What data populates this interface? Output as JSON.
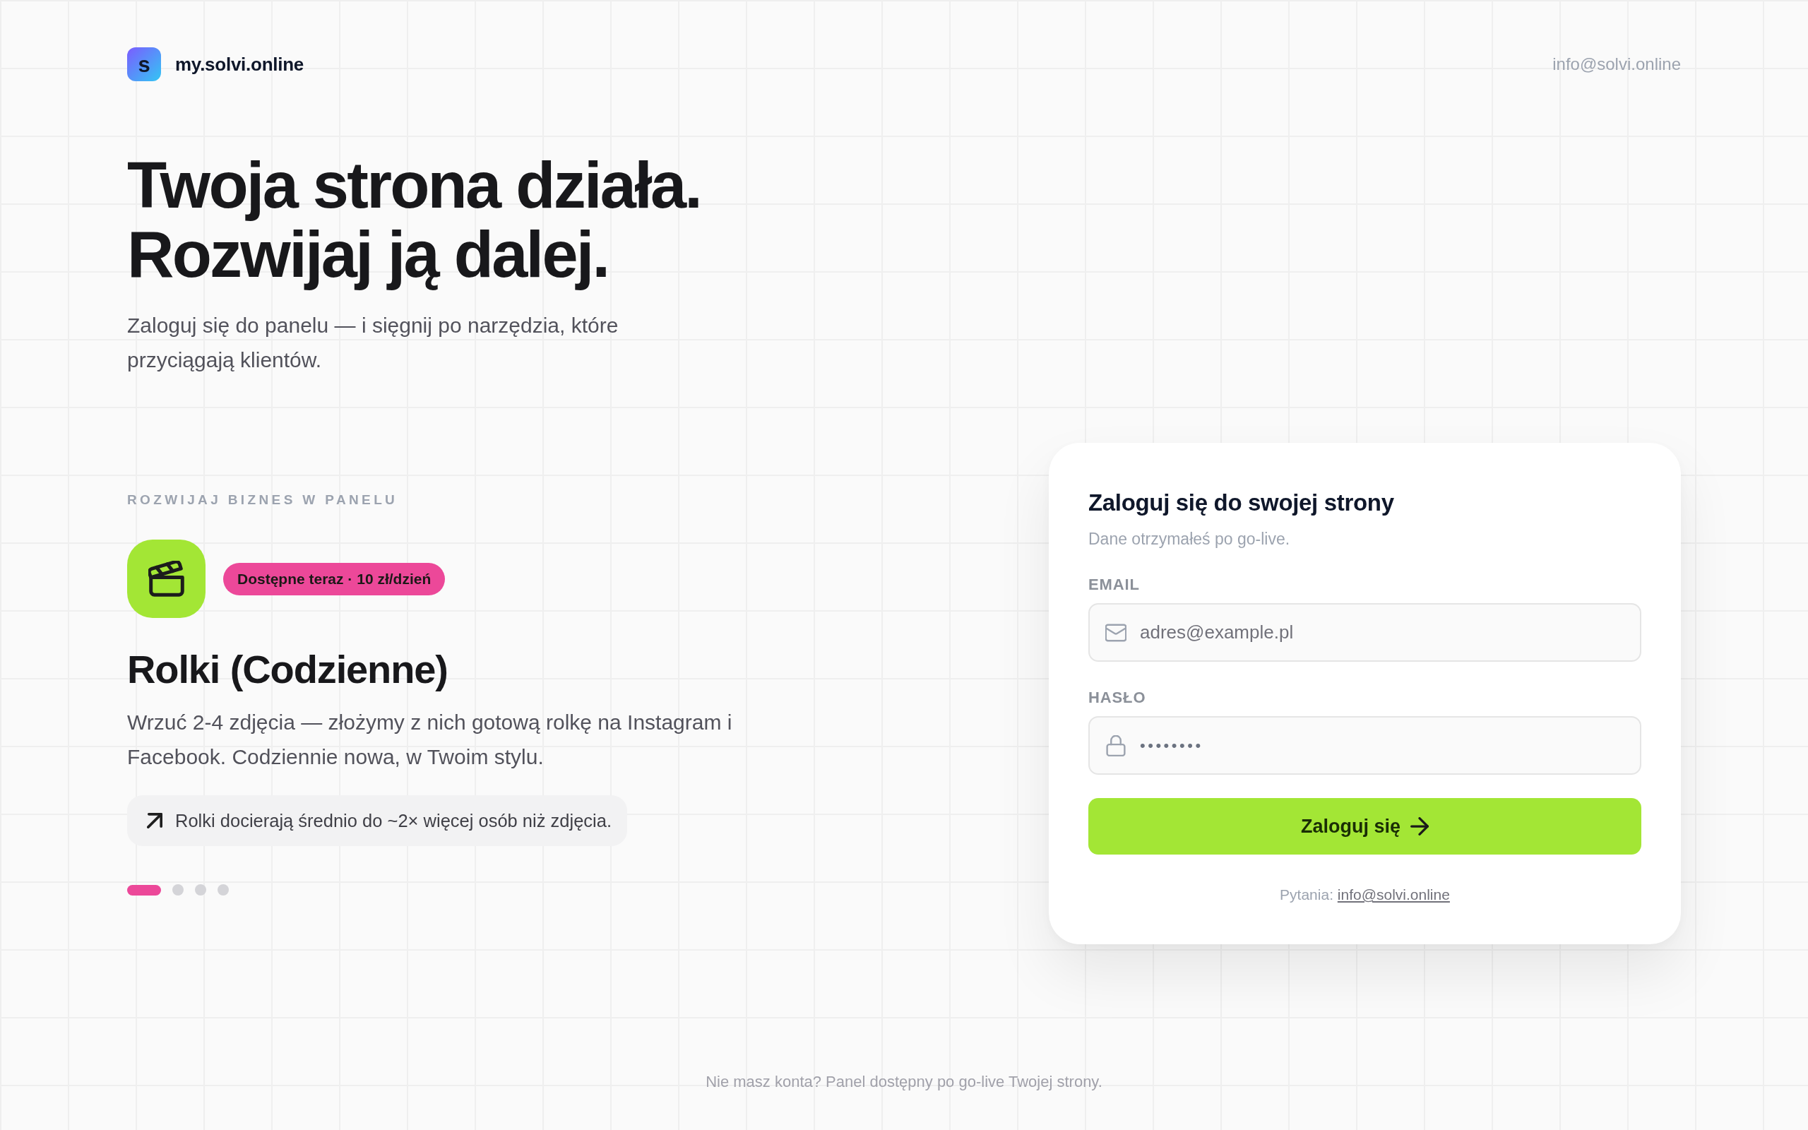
{
  "header": {
    "logo_letter": "s",
    "site_name": "my.solvi.online",
    "contact_email": "info@solvi.online"
  },
  "hero": {
    "title_lines": [
      "Twoja strona działa.",
      "Rozwijaj ją dalej."
    ],
    "subtitle": "Zaloguj się do panelu — i sięgnij po narzędzia, które przyciągają klientów."
  },
  "features": {
    "eyebrow": "ROZWIJAJ BIZNES W PANELU",
    "slide": {
      "badge": "Dostępne teraz · 10 zł/dzień",
      "title": "Rolki (Codzienne)",
      "description": "Wrzuć 2-4 zdjęcia — złożymy z nich gotową rolkę na Instagram i Facebook. Codziennie nowa, w Twoim stylu.",
      "note": "Rolki docierają średnio do ~2× więcej osób niż zdjęcia."
    },
    "dots": [
      {
        "selected": true
      },
      {
        "selected": false
      },
      {
        "selected": false
      },
      {
        "selected": false
      }
    ]
  },
  "login": {
    "title": "Zaloguj się do swojej strony",
    "subtitle": "Dane otrzymałeś po go-live.",
    "fields": [
      {
        "kind": "email",
        "label": "EMAIL",
        "placeholder": "adres@example.pl"
      },
      {
        "kind": "password",
        "label": "HASŁO",
        "value": "••••••••"
      }
    ],
    "submit": "Zaloguj się",
    "help_prefix": "Pytania:",
    "help_link": "info@solvi.online"
  },
  "footer": "Nie masz konta? Panel dostępny po go-live Twojej strony."
}
